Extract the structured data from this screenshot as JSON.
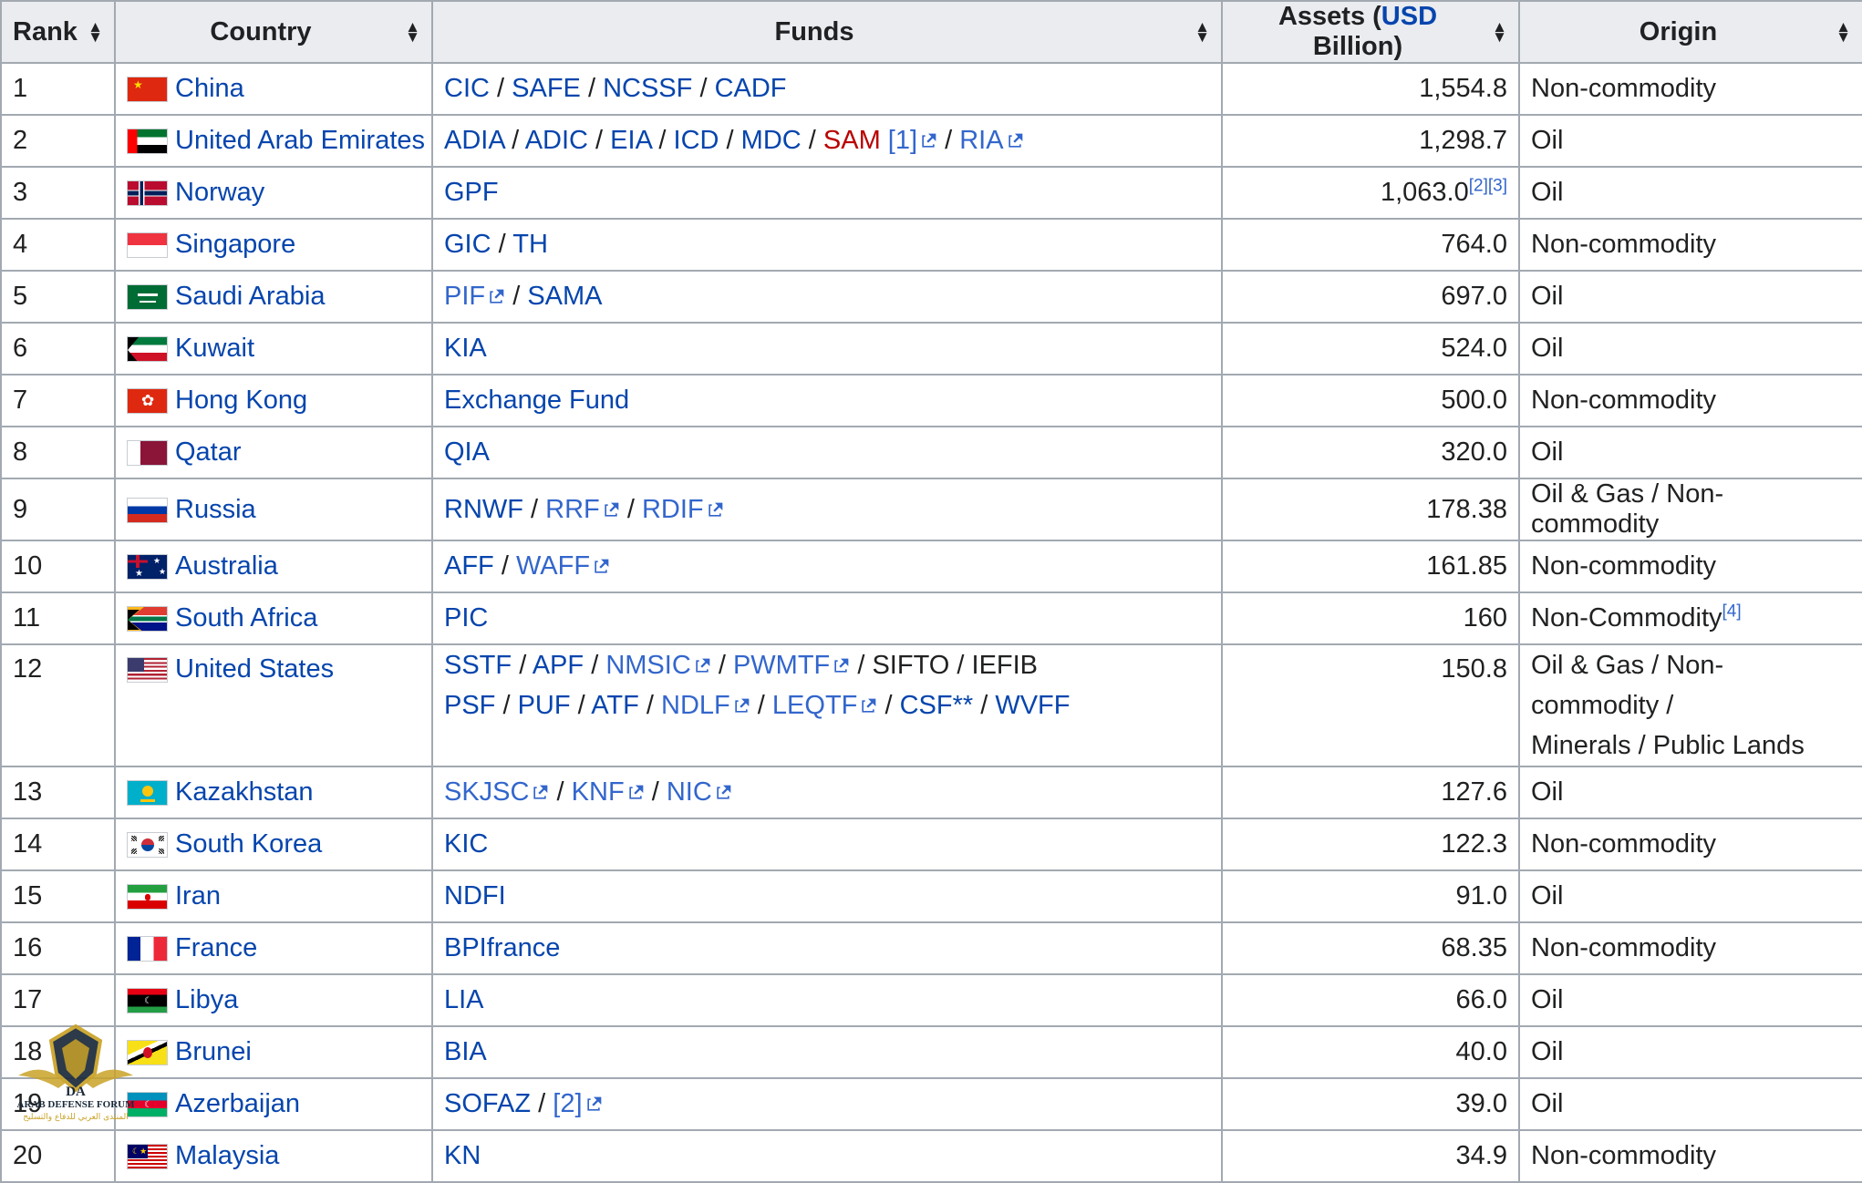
{
  "table": {
    "headers": {
      "rank": "Rank",
      "country": "Country",
      "funds": "Funds",
      "assets_prefix": "Assets (",
      "assets_link": "USD",
      "assets_suffix": " Billion)",
      "origin": "Origin"
    },
    "rows": [
      {
        "rank": "1",
        "country": "China",
        "assets": "1,554.8",
        "origin": "Non-commodity"
      },
      {
        "rank": "2",
        "country": "United Arab Emirates",
        "assets": "1,298.7",
        "origin": "Oil"
      },
      {
        "rank": "3",
        "country": "Norway",
        "assets": "1,063.0",
        "assets_refs": "[2][3]",
        "origin": "Oil"
      },
      {
        "rank": "4",
        "country": "Singapore",
        "assets": "764.0",
        "origin": "Non-commodity"
      },
      {
        "rank": "5",
        "country": "Saudi Arabia",
        "assets": "697.0",
        "origin": "Oil"
      },
      {
        "rank": "6",
        "country": "Kuwait",
        "assets": "524.0",
        "origin": "Oil"
      },
      {
        "rank": "7",
        "country": "Hong Kong",
        "assets": "500.0",
        "origin": "Non-commodity"
      },
      {
        "rank": "8",
        "country": "Qatar",
        "assets": "320.0",
        "origin": "Oil"
      },
      {
        "rank": "9",
        "country": "Russia",
        "assets": "178.38",
        "origin": "Oil & Gas / Non-commodity"
      },
      {
        "rank": "10",
        "country": "Australia",
        "assets": "161.85",
        "origin": "Non-commodity"
      },
      {
        "rank": "11",
        "country": "South Africa",
        "assets": "160",
        "origin": "Non-Commodity",
        "origin_ref": "[4]"
      },
      {
        "rank": "12",
        "country": "United States",
        "assets": "150.8",
        "origin_line1": "Oil & Gas / Non-commodity /",
        "origin_line2": "Minerals / Public Lands"
      },
      {
        "rank": "13",
        "country": "Kazakhstan",
        "assets": "127.6",
        "origin": "Oil"
      },
      {
        "rank": "14",
        "country": "South Korea",
        "assets": "122.3",
        "origin": "Non-commodity"
      },
      {
        "rank": "15",
        "country": "Iran",
        "assets": "91.0",
        "origin": "Oil"
      },
      {
        "rank": "16",
        "country": "France",
        "assets": "68.35",
        "origin": "Non-commodity"
      },
      {
        "rank": "17",
        "country": "Libya",
        "assets": "66.0",
        "origin": "Oil"
      },
      {
        "rank": "18",
        "country": "Brunei",
        "assets": "40.0",
        "origin": "Oil"
      },
      {
        "rank": "19",
        "country": "Azerbaijan",
        "assets": "39.0",
        "origin": "Oil"
      },
      {
        "rank": "20",
        "country": "Malaysia",
        "assets": "34.9",
        "origin": "Non-commodity"
      }
    ],
    "funds": {
      "r1": [
        "CIC",
        "SAFE",
        "NCSSF",
        "CADF"
      ],
      "r2": [
        "ADIA",
        "ADIC",
        "EIA",
        "ICD",
        "MDC",
        "SAM",
        "[1]",
        "RIA"
      ],
      "r3": [
        "GPF"
      ],
      "r4": [
        "GIC",
        "TH"
      ],
      "r5": [
        "PIF",
        "SAMA"
      ],
      "r6": [
        "KIA"
      ],
      "r7": [
        "Exchange Fund"
      ],
      "r8": [
        "QIA"
      ],
      "r9": [
        "RNWF",
        "RRF",
        "RDIF"
      ],
      "r10": [
        "AFF",
        "WAFF"
      ],
      "r11": [
        "PIC"
      ],
      "r12a": [
        "SSTF",
        "APF",
        "NMSIC",
        "PWMTF",
        "SIFTO",
        "IEFIB"
      ],
      "r12b": [
        "PSF",
        "PUF",
        "ATF",
        "NDLF",
        "LEQTF",
        "CSF**",
        "WVFF"
      ],
      "r13": [
        "SKJSC",
        "KNF",
        "NIC"
      ],
      "r14": [
        "KIC"
      ],
      "r15": [
        "NDFI"
      ],
      "r16": [
        "BPIfrance"
      ],
      "r17": [
        "LIA"
      ],
      "r18": [
        "BIA"
      ],
      "r19": [
        "SOFAZ",
        "[2]"
      ],
      "r20": [
        "KN"
      ]
    },
    "separator": "/"
  },
  "watermark": {
    "abbr": "DA",
    "name": "ARAB DEFENSE FORUM",
    "arabic": "المنتدى العربي للدفاع والتسليح"
  },
  "colors": {
    "link": "#0645ad",
    "external_link": "#3366cc",
    "redlink": "#ba0000",
    "header_bg": "#eaecf0",
    "border": "#a2a9b1",
    "text": "#202122"
  }
}
